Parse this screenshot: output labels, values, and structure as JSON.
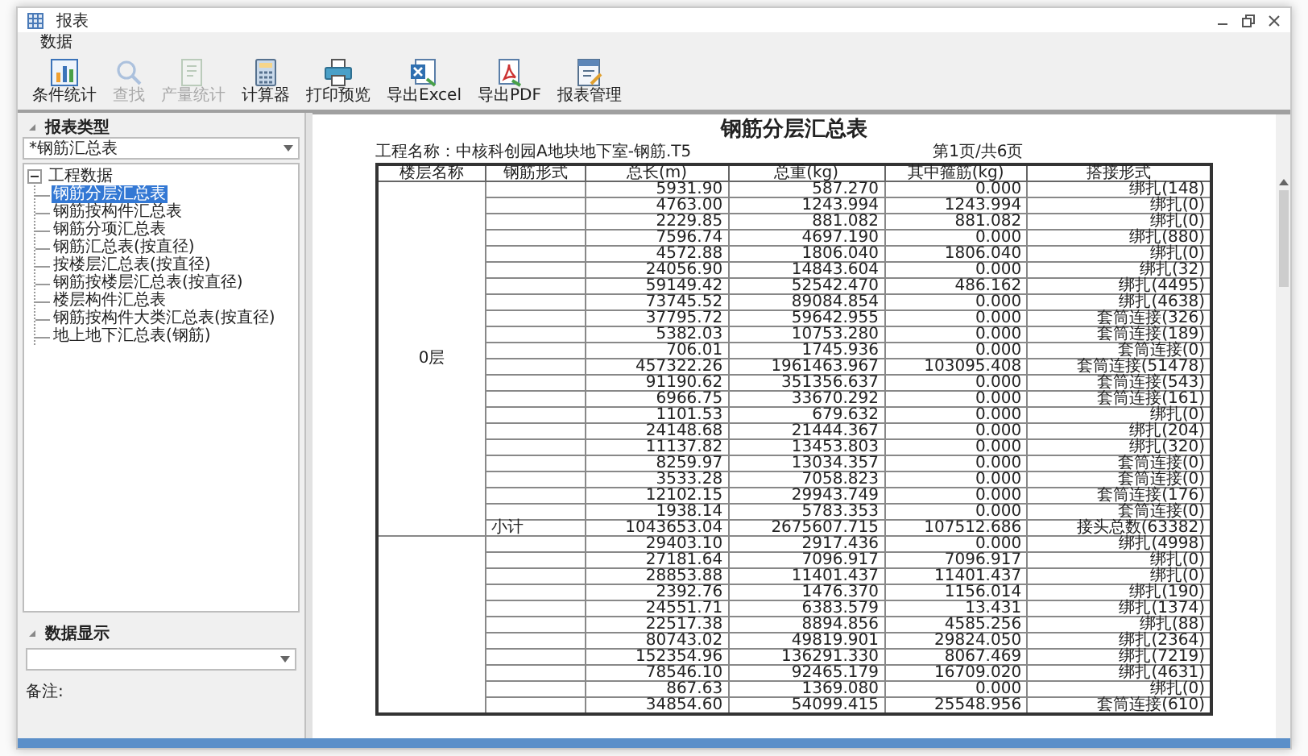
{
  "window": {
    "title": "报表"
  },
  "menu": [
    {
      "label": "数据"
    }
  ],
  "toolbar": [
    {
      "label": "条件统计",
      "disabled": false
    },
    {
      "label": "查找",
      "disabled": true
    },
    {
      "label": "产量统计",
      "disabled": true
    },
    {
      "label": "计算器",
      "disabled": false
    },
    {
      "label": "打印预览",
      "disabled": false
    },
    {
      "label": "导出Excel",
      "disabled": false
    },
    {
      "label": "导出PDF",
      "disabled": false
    },
    {
      "label": "报表管理",
      "disabled": false
    }
  ],
  "sidebar": {
    "header": "报表类型",
    "report_type": "*钢筋汇总表",
    "tree": [
      {
        "label": "工程数据",
        "expanded": true,
        "selected": false,
        "children": [
          {
            "label": "钢筋分层汇总表",
            "selected": true
          },
          {
            "label": "钢筋按构件汇总表",
            "selected": false
          },
          {
            "label": "钢筋分项汇总表",
            "selected": false
          },
          {
            "label": "钢筋汇总表(按直径)",
            "selected": false
          },
          {
            "label": "按楼层汇总表(按直径)",
            "selected": false
          },
          {
            "label": "钢筋按楼层汇总表(按直径)",
            "selected": false
          },
          {
            "label": "楼层构件汇总表",
            "selected": false
          },
          {
            "label": "钢筋按构件大类汇总表(按直径)",
            "selected": false
          },
          {
            "label": "地上地下汇总表(钢筋)",
            "selected": false
          }
        ]
      }
    ],
    "display_header": "数据显示",
    "remark_label": "备注:"
  },
  "report": {
    "title": "钢筋分层汇总表",
    "project": "工程名称：中核科创园A地块地下室-钢筋.T5",
    "page": "第1页/共6页",
    "columns": [
      "楼层名称",
      "钢筋形式",
      "总长(m)",
      "总重(kg)",
      "其中箍筋(kg)",
      "搭接形式"
    ],
    "groups": [
      {
        "floor": "0层",
        "rows": [
          [
            "5931.90",
            "587.270",
            "0.000",
            "绑扎(148)"
          ],
          [
            "4763.00",
            "1243.994",
            "1243.994",
            "绑扎(0)"
          ],
          [
            "2229.85",
            "881.082",
            "881.082",
            "绑扎(0)"
          ],
          [
            "7596.74",
            "4697.190",
            "0.000",
            "绑扎(880)"
          ],
          [
            "4572.88",
            "1806.040",
            "1806.040",
            "绑扎(0)"
          ],
          [
            "24056.90",
            "14843.604",
            "0.000",
            "绑扎(32)"
          ],
          [
            "59149.42",
            "52542.470",
            "486.162",
            "绑扎(4495)"
          ],
          [
            "73745.52",
            "89084.854",
            "0.000",
            "绑扎(4638)"
          ],
          [
            "37795.72",
            "59642.955",
            "0.000",
            "套筒连接(326)"
          ],
          [
            "5382.03",
            "10753.280",
            "0.000",
            "套筒连接(189)"
          ],
          [
            "706.01",
            "1745.936",
            "0.000",
            "套筒连接(0)"
          ],
          [
            "457322.26",
            "1961463.967",
            "103095.408",
            "套筒连接(51478)"
          ],
          [
            "91190.62",
            "351356.637",
            "0.000",
            "套筒连接(543)"
          ],
          [
            "6966.75",
            "33670.292",
            "0.000",
            "套筒连接(161)"
          ],
          [
            "1101.53",
            "679.632",
            "0.000",
            "绑扎(0)"
          ],
          [
            "24148.68",
            "21444.367",
            "0.000",
            "绑扎(204)"
          ],
          [
            "11137.82",
            "13453.803",
            "0.000",
            "绑扎(320)"
          ],
          [
            "8259.97",
            "13034.357",
            "0.000",
            "套筒连接(0)"
          ],
          [
            "3533.28",
            "7058.823",
            "0.000",
            "套筒连接(0)"
          ],
          [
            "12102.15",
            "29943.749",
            "0.000",
            "套筒连接(176)"
          ],
          [
            "1938.14",
            "5783.353",
            "0.000",
            "套筒连接(0)"
          ]
        ],
        "subtotal": {
          "label": "小计",
          "values": [
            "1043653.04",
            "2675607.715",
            "107512.686",
            "接头总数(63382)"
          ]
        }
      },
      {
        "rows": [
          [
            "29403.10",
            "2917.436",
            "0.000",
            "绑扎(4998)"
          ],
          [
            "27181.64",
            "7096.917",
            "7096.917",
            "绑扎(0)"
          ],
          [
            "28853.88",
            "11401.437",
            "11401.437",
            "绑扎(0)"
          ],
          [
            "2392.76",
            "1476.370",
            "1156.014",
            "绑扎(190)"
          ],
          [
            "24551.71",
            "6383.579",
            "13.431",
            "绑扎(1374)"
          ],
          [
            "22517.38",
            "8894.856",
            "4585.256",
            "绑扎(88)"
          ],
          [
            "80743.02",
            "49819.901",
            "29824.050",
            "绑扎(2364)"
          ],
          [
            "152354.96",
            "136291.330",
            "8067.469",
            "绑扎(7219)"
          ],
          [
            "78546.10",
            "92465.179",
            "16709.020",
            "绑扎(4631)"
          ],
          [
            "867.63",
            "1369.080",
            "0.000",
            "绑扎(0)"
          ],
          [
            "34854.60",
            "54099.415",
            "25548.956",
            "套筒连接(610)"
          ]
        ]
      }
    ]
  }
}
